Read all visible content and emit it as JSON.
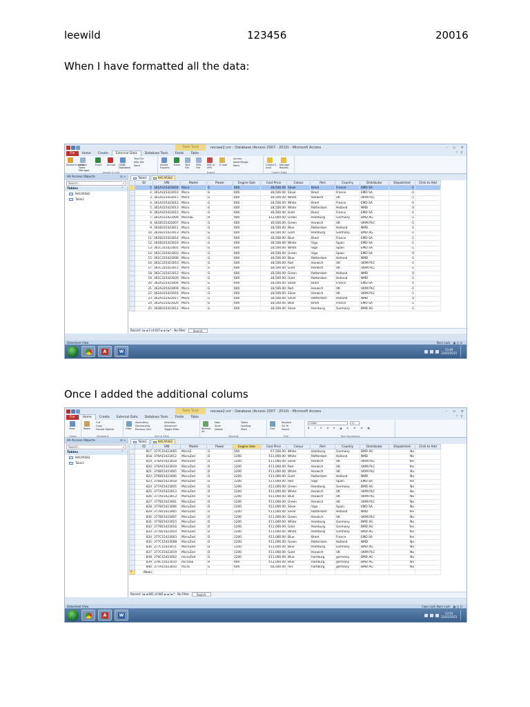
{
  "header": {
    "name": "leewild",
    "id": "123456",
    "code": "20016"
  },
  "captions": {
    "first": "When I have formatted all the data:",
    "second": "Once I added the additional colums"
  },
  "screenshot1": {
    "title": "nocase2.cnr : Database (Access 2007 - 2010) - Microsoft Access",
    "contextual_tab": "Table Tools",
    "tabs": [
      "File",
      "Home",
      "Create",
      "External Data",
      "Database Tools",
      "Fields",
      "Table"
    ],
    "active_tab": "External Data",
    "ribbon_groups": [
      {
        "label": "Import & Link",
        "items": [
          "Saved Imports",
          "Linked Table Manager",
          "Excel",
          "Access",
          "ODBC Database",
          "Text File",
          "XML File",
          "More"
        ]
      },
      {
        "label": "Export",
        "items": [
          "Saved Exports",
          "Excel",
          "Text File",
          "XML File",
          "PDF or XPS",
          "E-mail",
          "Access",
          "Word Merge",
          "More"
        ]
      },
      {
        "label": "Collect Data",
        "items": [
          "Create E-mail",
          "Manage Replies"
        ]
      }
    ],
    "nav": {
      "header": "All Access Objects",
      "search": "Search...",
      "section": "Tables",
      "items": [
        "NXCARS82",
        "Table1"
      ]
    },
    "doc_tabs": [
      "Table1",
      "NXCARS82"
    ],
    "columns": [
      "ID",
      "VIN",
      "Model",
      "Power",
      "Engine Size",
      "Cost Price",
      "Colour",
      "Port",
      "Country",
      "Distributor",
      "Dispatched",
      "Click to Add"
    ],
    "rows": [
      [
        "1",
        "361A315423004",
        "Micro",
        "G",
        "600",
        "£8,500.00",
        "Silver",
        "Brest",
        "France",
        "EMD SA",
        "-1"
      ],
      [
        "2",
        "361A315423010",
        "Micro",
        "G",
        "600",
        "£8,500.00",
        "Silver",
        "Brest",
        "France",
        "EMD SA",
        "-1"
      ],
      [
        "3",
        "361A315423011",
        "Micro",
        "G",
        "600",
        "£8,500.00",
        "White",
        "Harwich",
        "UK",
        "UKMI PLC",
        "-1"
      ],
      [
        "4",
        "361A315423012",
        "Micro",
        "G",
        "600",
        "£8,500.00",
        "White",
        "Brest",
        "France",
        "EMD SA",
        "-1"
      ],
      [
        "5",
        "361A315423013",
        "Micro",
        "G",
        "600",
        "£8,500.00",
        "White",
        "Rotterdam",
        "Holland",
        "NMD",
        "0"
      ],
      [
        "6",
        "361A315423015",
        "Micro",
        "G",
        "600",
        "£8,500.00",
        "Gold",
        "Brest",
        "France",
        "EMD SA",
        "-1"
      ],
      [
        "7",
        "361A315421009",
        "MicroSE",
        "H",
        "900",
        "£12,000.00",
        "Green",
        "Hamburg",
        "Germany",
        "BMD AG",
        "-1"
      ],
      [
        "8",
        "361B315422007",
        "Micro",
        "G",
        "600",
        "£8,500.00",
        "Green",
        "Harwich",
        "UK",
        "UKMI PLC",
        "-1"
      ],
      [
        "9",
        "361B315423011",
        "Micro",
        "G",
        "600",
        "£8,500.00",
        "Blue",
        "Rotterdam",
        "Holland",
        "NMD",
        "-1"
      ],
      [
        "10",
        "361B315423013",
        "Micro",
        "G",
        "600",
        "£8,500.00",
        "Gold",
        "Hamburg",
        "Germany",
        "BMD AG",
        "-1"
      ],
      [
        "11",
        "361B315423014",
        "Micro",
        "G",
        "600",
        "£8,500.00",
        "Blue",
        "Brest",
        "France",
        "EMD SA",
        "-1"
      ],
      [
        "12",
        "361B315423019",
        "Micro",
        "G",
        "600",
        "£8,500.00",
        "White",
        "Vigo",
        "Spain",
        "EMD SA",
        "-1"
      ],
      [
        "13",
        "361C315423001",
        "Micro",
        "G",
        "600",
        "£8,500.00",
        "White",
        "Vigo",
        "Spain",
        "EMD SA",
        "-1"
      ],
      [
        "14",
        "361C315423003",
        "Micro",
        "G",
        "600",
        "£8,500.00",
        "Green",
        "Vigo",
        "Spain",
        "EMD SA",
        "0"
      ],
      [
        "15",
        "361C315423006",
        "Micro",
        "G",
        "600",
        "£8,500.00",
        "Blue",
        "Rotterdam",
        "Holland",
        "NMD",
        "-1"
      ],
      [
        "16",
        "361C315423010",
        "Micro",
        "G",
        "600",
        "£8,500.00",
        "Red",
        "Harwich",
        "UK",
        "UKMI PLC",
        "-1"
      ],
      [
        "17",
        "361C315423011",
        "Micro",
        "G",
        "600",
        "£8,500.00",
        "Gold",
        "Harwich",
        "UK",
        "UKMI PLC",
        "-1"
      ],
      [
        "18",
        "361C315423012",
        "Micro",
        "G",
        "600",
        "£8,500.00",
        "Green",
        "Rotterdam",
        "Holland",
        "NMD",
        "0"
      ],
      [
        "19",
        "361C315423020",
        "Micro",
        "G",
        "600",
        "£8,500.00",
        "Gold",
        "Rotterdam",
        "Holland",
        "NMD",
        "-1"
      ],
      [
        "20",
        "362A315423004",
        "Micro",
        "G",
        "600",
        "£8,500.00",
        "Silver",
        "Brest",
        "France",
        "EMD SA",
        "-1"
      ],
      [
        "21",
        "362A315423009",
        "Micro",
        "G",
        "600",
        "£8,500.00",
        "Red",
        "Harwich",
        "UK",
        "UKMI PLC",
        "-1"
      ],
      [
        "22",
        "362A315423016",
        "Micro",
        "G",
        "600",
        "£8,500.00",
        "Silver",
        "Harwich",
        "UK",
        "UKMI PLC",
        "-1"
      ],
      [
        "23",
        "362A315423017",
        "Micro",
        "G",
        "600",
        "£8,500.00",
        "Silver",
        "Rotterdam",
        "Holland",
        "NMD",
        "0"
      ],
      [
        "24",
        "362A315423020",
        "Micro",
        "G",
        "600",
        "£8,500.00",
        "Blue",
        "Brest",
        "France",
        "EMD SA",
        "-1"
      ],
      [
        "25",
        "362B315423012",
        "Micro",
        "G",
        "600",
        "£8,500.00",
        "Silver",
        "Hamburg",
        "Germany",
        "BMD AG",
        "-1"
      ]
    ],
    "record_nav": "Record: I◄  ◄  1 of 837  ►  ►I  ►*",
    "filter": "No Filter",
    "search": "Search",
    "status_left": "Datasheet View",
    "status_right": "Num Lock",
    "clock_time": "13:49",
    "clock_date": "12/03/2015"
  },
  "screenshot2": {
    "title": "nocase2.cnr : Database (Access 2007 - 2010) - Microsoft Access",
    "contextual_tab": "Table Tools",
    "tabs": [
      "File",
      "Home",
      "Create",
      "External Data",
      "Database Tools",
      "Fields",
      "Table"
    ],
    "active_tab": "Home",
    "ribbon_groups": [
      {
        "label": "Views",
        "items": [
          "View"
        ]
      },
      {
        "label": "Clipboard",
        "items": [
          "Paste",
          "Cut",
          "Copy",
          "Format Painter"
        ]
      },
      {
        "label": "Sort & Filter",
        "items": [
          "Filter",
          "Ascending",
          "Descending",
          "Remove Sort",
          "Selection",
          "Advanced",
          "Toggle Filter"
        ]
      },
      {
        "label": "Records",
        "items": [
          "Refresh All",
          "New",
          "Save",
          "Delete",
          "Totals",
          "Spelling",
          "More"
        ]
      },
      {
        "label": "Find",
        "items": [
          "Find",
          "Replace",
          "Go To",
          "Select"
        ]
      },
      {
        "label": "Text Formatting",
        "items": [
          "Calibri",
          "11"
        ]
      }
    ],
    "nav": {
      "header": "All Access Objects",
      "search": "Search...",
      "section": "Tables",
      "items": [
        "NXCARS82",
        "Table1"
      ]
    },
    "doc_tabs": [
      "Table1",
      "NXCARS82"
    ],
    "columns": [
      "ID",
      "VIN",
      "Model",
      "Power",
      "Engine Size",
      "Cost Price",
      "Colour",
      "Port",
      "Country",
      "Distributor",
      "Dispatched",
      "Click to Add"
    ],
    "rows": [
      [
        "817",
        "377C15423005",
        "MicroS",
        "G",
        "500",
        "€7,500.00",
        "White",
        "Hamburg",
        "Germany",
        "BMD AG",
        "No"
      ],
      [
        "818",
        "379A15423012",
        "MicroZed",
        "D",
        "1200",
        "€11,000.00",
        "White",
        "Rotterdam",
        "Holland",
        "NMD",
        "No"
      ],
      [
        "819",
        "376A15423018",
        "MicroZed",
        "D",
        "1200",
        "€11,000.00",
        "Silver",
        "Harwich",
        "UK",
        "UKMI PLC",
        "Yes"
      ],
      [
        "820",
        "376A15423019",
        "MicroZed",
        "D",
        "1200",
        "€11,000.00",
        "Red",
        "Harwich",
        "UK",
        "UKMI PLC",
        "Yes"
      ],
      [
        "821",
        "376B15423005",
        "MicroZed",
        "D",
        "1200",
        "€11,000.00",
        "White",
        "Harwich",
        "UK",
        "UKMI PLC",
        "No"
      ],
      [
        "822",
        "376B15423006",
        "MicroZed",
        "D",
        "1200",
        "€11,000.00",
        "Gold",
        "Rotterdam",
        "Holland",
        "NMD",
        "No"
      ],
      [
        "823",
        "376B15423018",
        "MicroZed",
        "D",
        "1200",
        "€11,000.00",
        "Red",
        "Vigo",
        "Spain",
        "EMD SA",
        "Yes"
      ],
      [
        "824",
        "377A15423005",
        "MicroZed",
        "D",
        "1200",
        "€11,000.00",
        "Green",
        "Hamburg",
        "Germany",
        "BMD AG",
        "No"
      ],
      [
        "825",
        "377A15423013",
        "MicroZed",
        "D",
        "1200",
        "€11,000.00",
        "White",
        "Harwich",
        "UK",
        "UKMI PLC",
        "No"
      ],
      [
        "826",
        "377A15423013",
        "MicroZed",
        "D",
        "1200",
        "€11,000.00",
        "Blue",
        "Harwich",
        "UK",
        "UKMI PLC",
        "No"
      ],
      [
        "827",
        "377B15423001",
        "MicroZed",
        "D",
        "1200",
        "€11,000.00",
        "Green",
        "Harwich",
        "UK",
        "UKMI PLC",
        "No"
      ],
      [
        "828",
        "377B15423006",
        "MicroZed",
        "D",
        "1200",
        "€11,000.00",
        "Silver",
        "Vigo",
        "Spain",
        "EMD SA",
        "No"
      ],
      [
        "829",
        "377B15423005",
        "MicroZed",
        "D",
        "1200",
        "€11,000.00",
        "Silver",
        "Rotterdam",
        "Holland",
        "NMD",
        "Yes"
      ],
      [
        "830",
        "377B15423007",
        "MicroZed",
        "D",
        "1200",
        "€11,000.00",
        "Green",
        "Harwich",
        "UK",
        "UKMI PLC",
        "No"
      ],
      [
        "831",
        "377B15423015",
        "MicroZed",
        "D",
        "1200",
        "€11,000.00",
        "White",
        "Hamburg",
        "Germany",
        "BMD AG",
        "No"
      ],
      [
        "832",
        "377B15423016",
        "MicroZed",
        "D",
        "1200",
        "€11,000.00",
        "Gold",
        "Hamburg",
        "Germany",
        "BMD AG",
        "Yes"
      ],
      [
        "833",
        "377B15423019",
        "MicroZed",
        "D",
        "1200",
        "€11,000.00",
        "White",
        "Hamburg",
        "Germany",
        "BMD AG",
        "Yes"
      ],
      [
        "834",
        "377C15423003",
        "MicroZed",
        "D",
        "1200",
        "€11,000.00",
        "Blue",
        "Brest",
        "France",
        "EMD SA",
        "Yes"
      ],
      [
        "835",
        "377C15423008",
        "MicroZed",
        "D",
        "1200",
        "€11,000.00",
        "Green",
        "Rotterdam",
        "Holland",
        "NMD",
        "No"
      ],
      [
        "836",
        "377C15423011",
        "MicroZed",
        "D",
        "1200",
        "€11,000.00",
        "Blue",
        "Hamburg",
        "Germany",
        "BMD AG",
        "No"
      ],
      [
        "837",
        "377C15423019",
        "MicroZed",
        "D",
        "1200",
        "€11,000.00",
        "Gold",
        "Harwich",
        "UK",
        "UKMI PLC",
        "No"
      ],
      [
        "838",
        "376C15423002",
        "microZed",
        "D",
        "1200",
        "€11,000.00",
        "Blue",
        "hamburg",
        "germany",
        "BMD AG",
        "No"
      ],
      [
        "839",
        "376C15423010",
        "microSE",
        "H",
        "900",
        "€12,000.00",
        "Blue",
        "hamburg",
        "germany",
        "BMD AG",
        "No"
      ],
      [
        "840",
        "377A15423010",
        "micro",
        "G",
        "600",
        "€8,500.00",
        "red",
        "hamburg",
        "germany",
        "BMD AG",
        "No"
      ]
    ],
    "new_row_label": "(New)",
    "record_nav": "Record: I◄  ◄  841 of 841  ►  ►I  ►*",
    "filter": "No Filter",
    "search": "Search",
    "status_left": "Datasheet View",
    "status_right": "Caps Lock   Num Lock",
    "clock_time": "13:50",
    "clock_date": "12/03/2015"
  },
  "colors": {
    "file_tab": "#b8332e",
    "ribbon": "#f3f7fc",
    "taskbar": "#3a5f8a",
    "header_highlight": "#f6de8a",
    "selected_row": "#a7c6f2"
  }
}
